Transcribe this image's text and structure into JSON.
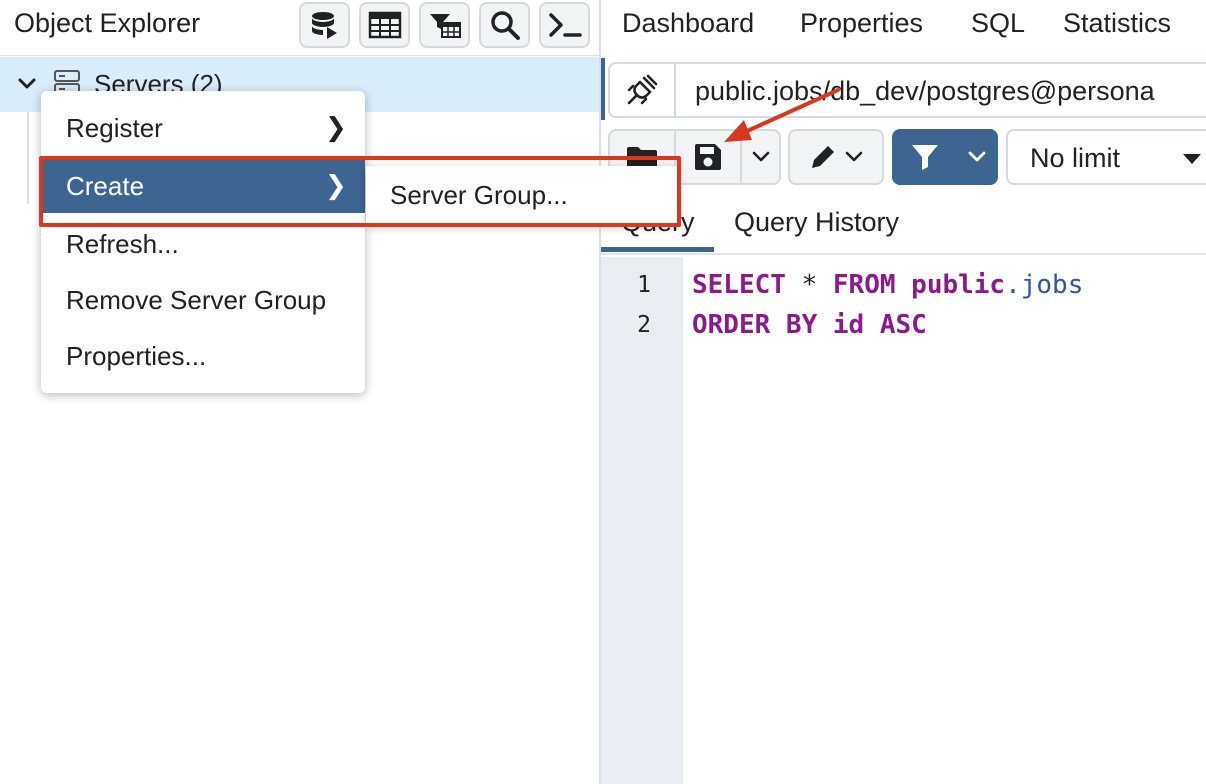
{
  "object_explorer": {
    "title": "Object Explorer",
    "toolbar": [
      {
        "name": "database-icon"
      },
      {
        "name": "table-icon"
      },
      {
        "name": "filter-table-icon"
      },
      {
        "name": "search-icon"
      },
      {
        "name": "terminal-icon"
      }
    ],
    "tree": {
      "servers_label": "Servers (2)"
    }
  },
  "context_menu": {
    "items": [
      {
        "label": "Register",
        "has_submenu": true
      },
      {
        "label": "Create",
        "has_submenu": true,
        "active": true
      },
      {
        "label": "Refresh...",
        "has_submenu": false
      },
      {
        "label": "Remove Server Group",
        "has_submenu": false
      },
      {
        "label": "Properties...",
        "has_submenu": false
      }
    ],
    "submenu": {
      "items": [
        {
          "label": "Server Group..."
        }
      ]
    },
    "submenu_arrow_glyph": "❯"
  },
  "tabs": [
    "Dashboard",
    "Properties",
    "SQL",
    "Statistics"
  ],
  "query_tool": {
    "connection": "public.jobs/db_dev/postgres@persona",
    "limit": {
      "selected": "No limit"
    },
    "editor_tabs": [
      "Query",
      "Query History"
    ],
    "lines": [
      {
        "number": "1",
        "tokens": [
          {
            "text": "SELECT",
            "type": "keyword"
          },
          {
            "text": " * ",
            "type": "op"
          },
          {
            "text": "FROM",
            "type": "keyword"
          },
          {
            "text": " public",
            "type": "keyword"
          },
          {
            "text": ".",
            "type": "dot"
          },
          {
            "text": "jobs",
            "type": "ident"
          }
        ]
      },
      {
        "number": "2",
        "tokens": [
          {
            "text": "ORDER BY",
            "type": "keyword"
          },
          {
            "text": " id ",
            "type": "keyword"
          },
          {
            "text": "ASC",
            "type": "keyword"
          }
        ]
      }
    ]
  },
  "annotation_colors": {
    "highlight": "#d9381f",
    "accent": "#3d6591",
    "selection": "#d9ecfa"
  }
}
